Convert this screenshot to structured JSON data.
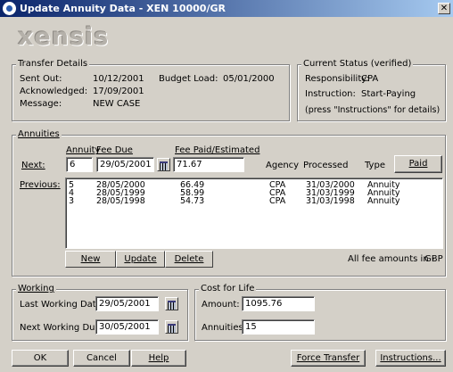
{
  "window": {
    "title": "Update Annuity Data - XEN 10000/GR",
    "close_glyph": "✕"
  },
  "logo": "xensis",
  "transfer": {
    "legend": "Transfer Details",
    "sent_out_label": "Sent Out:",
    "sent_out": "10/12/2001",
    "budget_load_label": "Budget Load:",
    "budget_load": "05/01/2000",
    "acknowledged_label": "Acknowledged:",
    "acknowledged": "17/09/2001",
    "message_label": "Message:",
    "message": "NEW CASE"
  },
  "status": {
    "legend": "Current Status (verified)",
    "responsibility_label": "Responsibility:",
    "responsibility": "CPA",
    "instruction_label": "Instruction:",
    "instruction": "Start-Paying",
    "hint": "(press \"Instructions\" for details)"
  },
  "annuities": {
    "legend": "Annuities",
    "col_annuity": "Annuity",
    "col_fee_due": "Fee Due",
    "col_fee_paid": "Fee Paid/Estimated",
    "col_agency": "Agency",
    "col_processed": "Processed",
    "col_type": "Type",
    "next_label": "Next:",
    "next_annuity": "6",
    "next_fee_due": "29/05/2001",
    "next_fee_paid": "71.67",
    "paid_button": "Paid",
    "previous_label": "Previous:",
    "previous": [
      {
        "annuity": "5",
        "due": "28/05/2000",
        "fee": "66.49",
        "agency": "CPA",
        "processed": "31/03/2000",
        "type": "Annuity"
      },
      {
        "annuity": "4",
        "due": "28/05/1999",
        "fee": "58.99",
        "agency": "CPA",
        "processed": "31/03/1999",
        "type": "Annuity"
      },
      {
        "annuity": "3",
        "due": "28/05/1998",
        "fee": "54.73",
        "agency": "CPA",
        "processed": "31/03/1998",
        "type": "Annuity"
      }
    ],
    "new_button": "New",
    "update_button": "Update",
    "delete_button": "Delete",
    "currency_note": "All fee amounts in -",
    "currency": "GBP"
  },
  "working": {
    "legend": "Working",
    "last_label": "Last Working Date:",
    "last_value": "29/05/2001",
    "next_label": "Next Working Due:",
    "next_value": "30/05/2001"
  },
  "cost": {
    "legend": "Cost for Life",
    "amount_label": "Amount:",
    "amount": "1095.76",
    "annuities_label": "Annuities:",
    "annuities": "15"
  },
  "footer": {
    "ok": "OK",
    "cancel": "Cancel",
    "help": "Help",
    "force_transfer": "Force Transfer",
    "instructions": "Instructions..."
  }
}
